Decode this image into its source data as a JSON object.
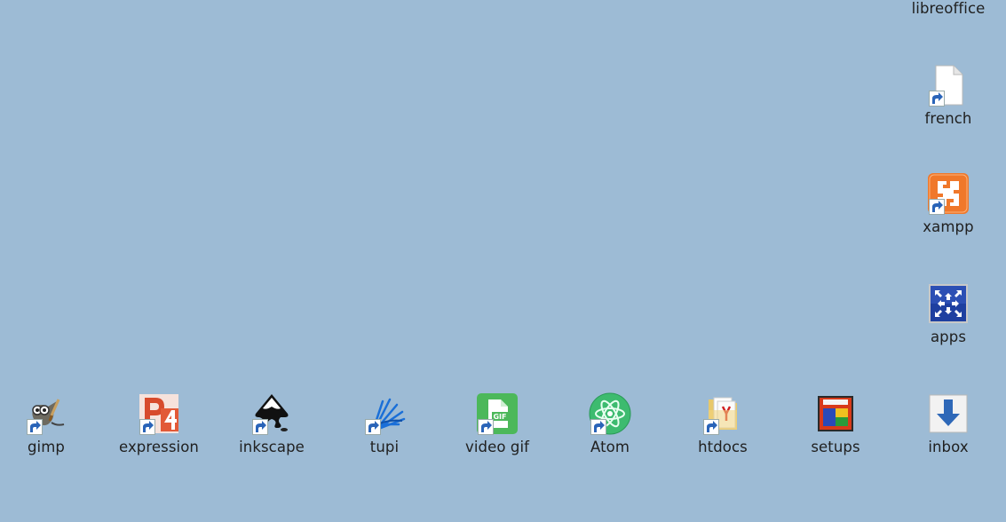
{
  "desktop": {
    "icons": [
      {
        "id": "libreoffice",
        "label": "libreoffice",
        "icon": "libreoffice-icon"
      },
      {
        "id": "french",
        "label": "french",
        "icon": "blank-file-icon"
      },
      {
        "id": "xampp",
        "label": "xampp",
        "icon": "xampp-icon"
      },
      {
        "id": "apps",
        "label": "apps",
        "icon": "apps-icon"
      },
      {
        "id": "gimp",
        "label": "gimp",
        "icon": "gimp-icon"
      },
      {
        "id": "expression",
        "label": "expression",
        "icon": "expression-icon"
      },
      {
        "id": "inkscape",
        "label": "inkscape",
        "icon": "inkscape-icon"
      },
      {
        "id": "tupi",
        "label": "tupi",
        "icon": "tupi-icon"
      },
      {
        "id": "video-gif",
        "label": "video gif",
        "icon": "gif-file-icon"
      },
      {
        "id": "atom",
        "label": "Atom",
        "icon": "atom-icon"
      },
      {
        "id": "htdocs",
        "label": "htdocs",
        "icon": "folder-icon"
      },
      {
        "id": "setups",
        "label": "setups",
        "icon": "setups-icon"
      },
      {
        "id": "inbox",
        "label": "inbox",
        "icon": "download-arrow-icon"
      }
    ],
    "colors": {
      "background": "#9dbbd5",
      "xampp": "#f0782a",
      "atom": "#3dbb6f",
      "gif": "#4cb85a",
      "apps": "#1e3fa0"
    }
  }
}
